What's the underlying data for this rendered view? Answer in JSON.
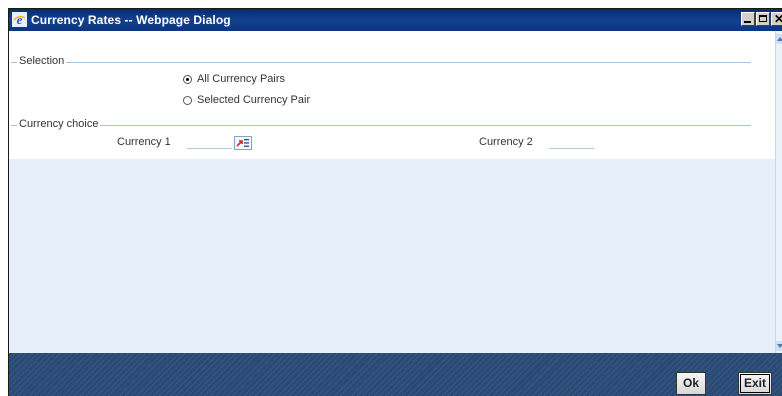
{
  "window": {
    "title": "Currency Rates -- Webpage Dialog",
    "icon": "ie-icon",
    "controls": [
      "minimize-icon",
      "maximize-icon",
      "close-icon"
    ]
  },
  "selection": {
    "legend": "Selection",
    "options": [
      {
        "label": "All Currency Pairs",
        "checked": true
      },
      {
        "label": "Selected Currency Pair",
        "checked": false
      }
    ]
  },
  "currency_choice": {
    "legend": "Currency choice",
    "currency1_label": "Currency 1",
    "currency1_value": "",
    "currency2_label": "Currency 2",
    "currency2_value": ""
  },
  "footer": {
    "ok_label": "Ok",
    "exit_label": "Exit"
  }
}
